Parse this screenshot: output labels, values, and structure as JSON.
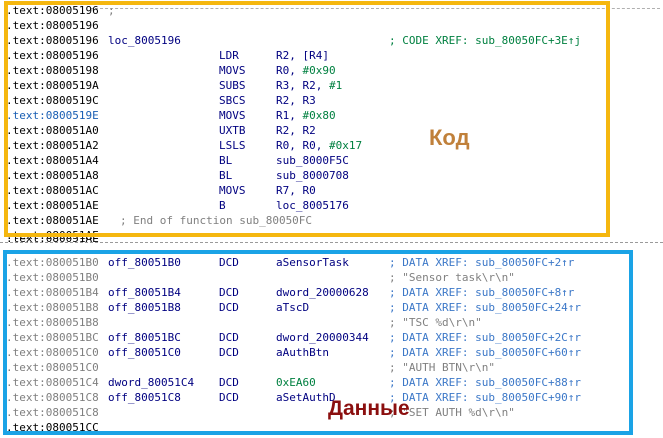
{
  "colors": {
    "code_box": "#f5b70f",
    "data_box": "#1aa3e6",
    "code_label": "#c0803a",
    "data_label": "#8b0f0f",
    "mnemonic": "#000080",
    "number": "#008040",
    "xref_data": "#3c78c8"
  },
  "labels": {
    "code_region": "Код",
    "data_region": "Данные"
  },
  "code_rows": [
    {
      "addr": ".text:08005196",
      "label": "",
      "mnem": "",
      "ops": "",
      "comment": ";",
      "addr_style": "black"
    },
    {
      "addr": ".text:08005196",
      "label": "",
      "mnem": "",
      "ops": "",
      "comment": "",
      "addr_style": "black"
    },
    {
      "addr": ".text:08005196",
      "label": "loc_8005196",
      "mnem": "",
      "ops": "",
      "comment": "; CODE XREF: sub_80050FC+3E↑j",
      "addr_style": "black"
    },
    {
      "addr": ".text:08005196",
      "label": "",
      "mnem": "LDR",
      "ops": "R2, [R4]",
      "comment": "",
      "addr_style": "black"
    },
    {
      "addr": ".text:08005198",
      "label": "",
      "mnem": "MOVS",
      "ops": "R0, #0x90",
      "comment": "",
      "addr_style": "black"
    },
    {
      "addr": ".text:0800519A",
      "label": "",
      "mnem": "SUBS",
      "ops": "R3, R2, #1",
      "comment": "",
      "addr_style": "black"
    },
    {
      "addr": ".text:0800519C",
      "label": "",
      "mnem": "SBCS",
      "ops": "R2, R3",
      "comment": "",
      "addr_style": "black"
    },
    {
      "addr": ".text:0800519E",
      "label": "",
      "mnem": "MOVS",
      "ops": "R1, #0x80",
      "comment": "",
      "addr_style": "blue"
    },
    {
      "addr": ".text:080051A0",
      "label": "",
      "mnem": "UXTB",
      "ops": "R2, R2",
      "comment": "",
      "addr_style": "black"
    },
    {
      "addr": ".text:080051A2",
      "label": "",
      "mnem": "LSLS",
      "ops": "R0, R0, #0x17",
      "comment": "",
      "addr_style": "black"
    },
    {
      "addr": ".text:080051A4",
      "label": "",
      "mnem": "BL",
      "ops": "sub_8000F5C",
      "comment": "",
      "addr_style": "black"
    },
    {
      "addr": ".text:080051A8",
      "label": "",
      "mnem": "BL",
      "ops": "sub_8000708",
      "comment": "",
      "addr_style": "black"
    },
    {
      "addr": ".text:080051AC",
      "label": "",
      "mnem": "MOVS",
      "ops": "R7, R0",
      "comment": "",
      "addr_style": "black"
    },
    {
      "addr": ".text:080051AE",
      "label": "",
      "mnem": "B",
      "ops": "loc_8005176",
      "comment": "",
      "addr_style": "black"
    },
    {
      "addr": ".text:080051AE",
      "label": "",
      "mnem": "",
      "ops": "",
      "comment": "",
      "end_comment": "; End of function sub_80050FC",
      "addr_style": "black"
    },
    {
      "addr": ".text:080051AE",
      "label": "",
      "mnem": "",
      "ops": "",
      "comment": "",
      "addr_style": "black"
    }
  ],
  "partial_row": {
    "addr": ".text:080051AE"
  },
  "data_rows": [
    {
      "addr": ".text:080051B0",
      "label": "off_80051B0",
      "mnem": "DCD",
      "ops": "aSensorTask",
      "comment": "; DATA XREF: sub_80050FC+2↑r",
      "ctype": "xref",
      "addr_style": "gray"
    },
    {
      "addr": ".text:080051B0",
      "label": "",
      "mnem": "",
      "ops": "",
      "comment": "; \"Sensor task\\r\\n\"",
      "ctype": "str",
      "addr_style": "gray"
    },
    {
      "addr": ".text:080051B4",
      "label": "off_80051B4",
      "mnem": "DCD",
      "ops": "dword_20000628",
      "comment": "; DATA XREF: sub_80050FC+8↑r",
      "ctype": "xref",
      "addr_style": "gray"
    },
    {
      "addr": ".text:080051B8",
      "label": "off_80051B8",
      "mnem": "DCD",
      "ops": "aTscD",
      "comment": "; DATA XREF: sub_80050FC+24↑r",
      "ctype": "xref",
      "addr_style": "gray"
    },
    {
      "addr": ".text:080051B8",
      "label": "",
      "mnem": "",
      "ops": "",
      "comment": "; \"TSC %d\\r\\n\"",
      "ctype": "str",
      "addr_style": "gray"
    },
    {
      "addr": ".text:080051BC",
      "label": "off_80051BC",
      "mnem": "DCD",
      "ops": "dword_20000344",
      "comment": "; DATA XREF: sub_80050FC+2C↑r",
      "ctype": "xref",
      "addr_style": "gray"
    },
    {
      "addr": ".text:080051C0",
      "label": "off_80051C0",
      "mnem": "DCD",
      "ops": "aAuthBtn",
      "comment": "; DATA XREF: sub_80050FC+60↑r",
      "ctype": "xref",
      "addr_style": "gray"
    },
    {
      "addr": ".text:080051C0",
      "label": "",
      "mnem": "",
      "ops": "",
      "comment": "; \"AUTH BTN\\r\\n\"",
      "ctype": "str",
      "addr_style": "gray"
    },
    {
      "addr": ".text:080051C4",
      "label": "dword_80051C4",
      "mnem": "DCD",
      "ops": "0xEA60",
      "comment": "; DATA XREF: sub_80050FC+88↑r",
      "ctype": "xref",
      "addr_style": "gray"
    },
    {
      "addr": ".text:080051C8",
      "label": "off_80051C8",
      "mnem": "DCD",
      "ops": "aSetAuthD",
      "comment": "; DATA XREF: sub_80050FC+90↑r",
      "ctype": "xref",
      "addr_style": "gray"
    },
    {
      "addr": ".text:080051C8",
      "label": "",
      "mnem": "",
      "ops": "",
      "comment": "; \"SET AUTH %d\\r\\n\"",
      "ctype": "str",
      "addr_style": "gray"
    },
    {
      "addr": ".text:080051CC",
      "label": "",
      "mnem": "",
      "ops": "",
      "comment": "",
      "ctype": "none",
      "addr_style": "black"
    }
  ]
}
